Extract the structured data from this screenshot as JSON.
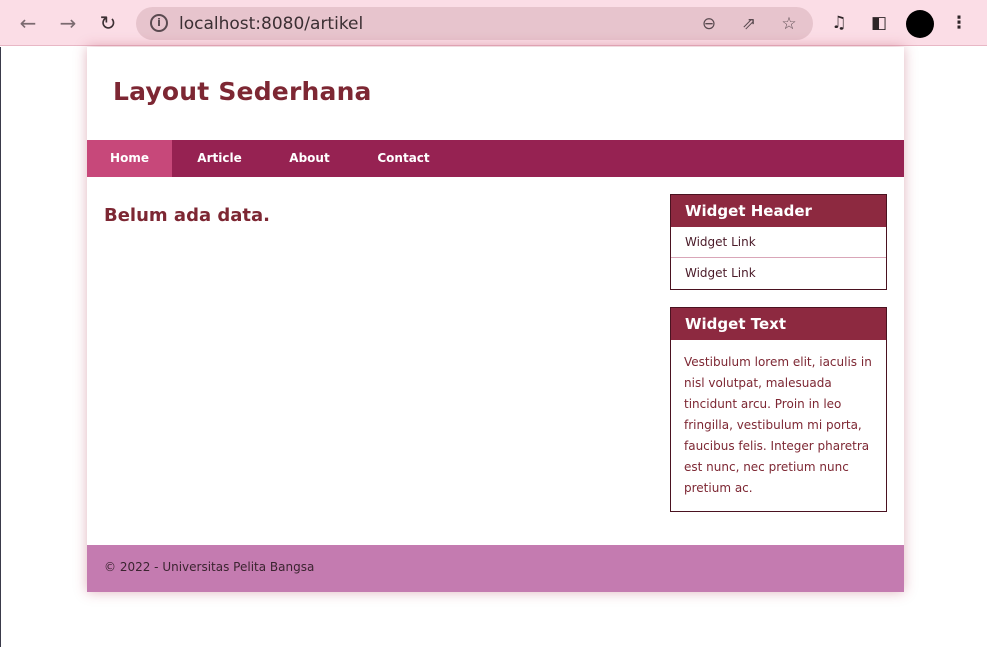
{
  "browser": {
    "url": "localhost:8080/artikel",
    "icons": [
      "back-icon",
      "forward-icon",
      "reload-icon",
      "info-icon",
      "zoom-out-icon",
      "share-icon",
      "star-icon",
      "media-icon",
      "side-panel-icon",
      "profile-avatar",
      "more-menu-icon"
    ]
  },
  "page": {
    "site_title": "Layout Sederhana",
    "nav": [
      {
        "label": "Home",
        "active": true
      },
      {
        "label": "Article",
        "active": false
      },
      {
        "label": "About",
        "active": false
      },
      {
        "label": "Contact",
        "active": false
      }
    ],
    "content_heading": "Belum ada data.",
    "widget_links": {
      "header": "Widget Header",
      "links": [
        "Widget Link",
        "Widget Link"
      ]
    },
    "widget_text": {
      "header": "Widget Text",
      "body": "Vestibulum lorem elit, iaculis in nisl volutpat, malesuada tincidunt arcu. Proin in leo fringilla, vestibulum mi porta, faucibus felis. Integer pharetra est nunc, nec pretium nunc pretium ac."
    },
    "footer": "© 2022 - Universitas Pelita Bangsa"
  },
  "colors": {
    "nav_bg": "#962252",
    "nav_active": "#c7487a",
    "title": "#7d2733",
    "widget_header": "#8d2940",
    "footer_bg": "#c47bb0"
  }
}
